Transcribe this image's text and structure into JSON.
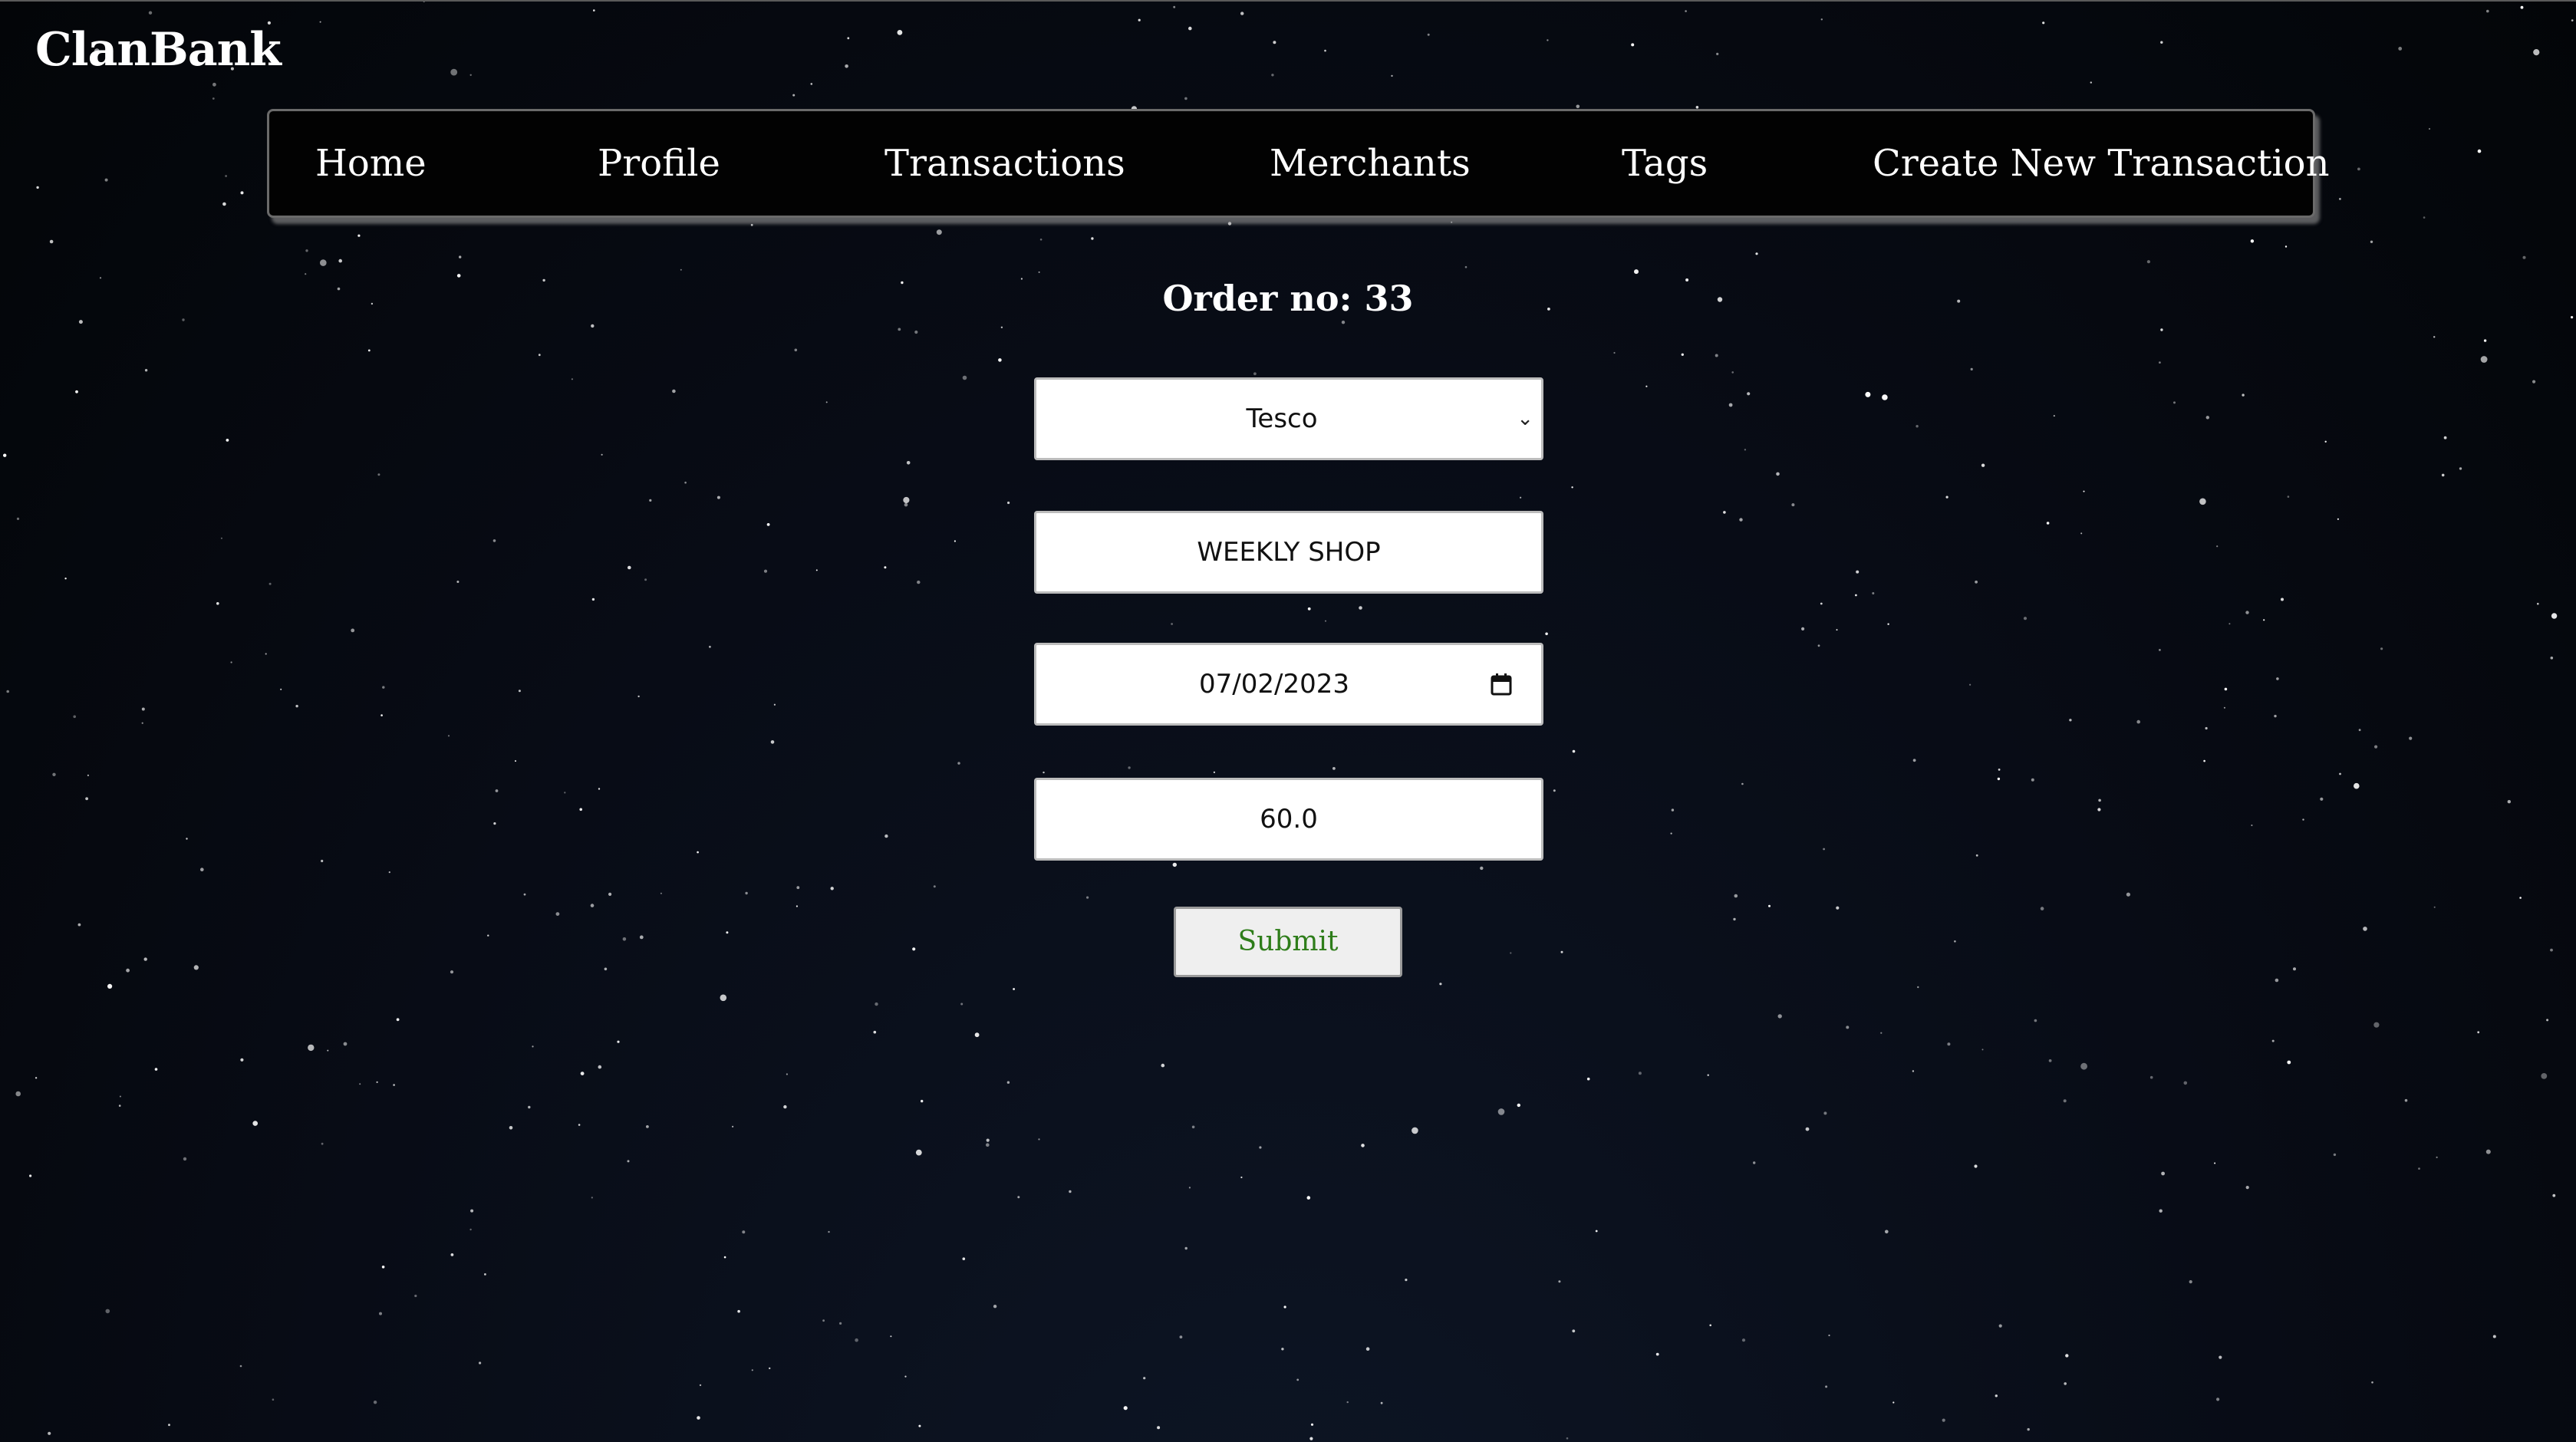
{
  "app": {
    "title": "ClanBank"
  },
  "nav": {
    "items": [
      {
        "label": "Home"
      },
      {
        "label": "Profile"
      },
      {
        "label": "Transactions"
      },
      {
        "label": "Merchants"
      },
      {
        "label": "Tags"
      },
      {
        "label": "Create New Transaction"
      }
    ]
  },
  "form": {
    "order_title": "Order no: 33",
    "merchant_select": {
      "value": "Tesco"
    },
    "description_input": {
      "value": "WEEKLY SHOP"
    },
    "date_input": {
      "value": "07/02/2023"
    },
    "amount_input": {
      "value": "60.0"
    },
    "submit_label": "Submit"
  },
  "colors": {
    "background": "#05080f",
    "navbar": "#020202",
    "submit_text": "#2e7d1a",
    "field_background": "#ffffff"
  },
  "icons": {
    "select": "chevron-down-icon",
    "date": "calendar-icon"
  }
}
